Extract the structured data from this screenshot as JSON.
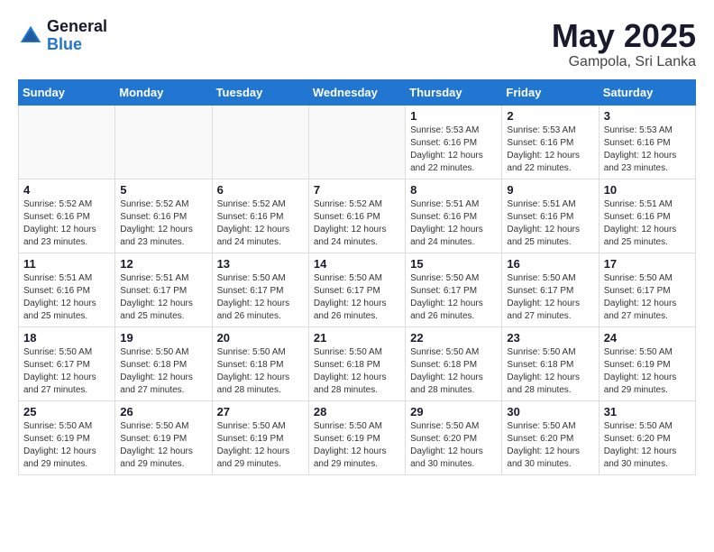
{
  "header": {
    "logo_general": "General",
    "logo_blue": "Blue",
    "title": "May 2025",
    "location": "Gampola, Sri Lanka"
  },
  "weekdays": [
    "Sunday",
    "Monday",
    "Tuesday",
    "Wednesday",
    "Thursday",
    "Friday",
    "Saturday"
  ],
  "weeks": [
    [
      {
        "day": "",
        "info": ""
      },
      {
        "day": "",
        "info": ""
      },
      {
        "day": "",
        "info": ""
      },
      {
        "day": "",
        "info": ""
      },
      {
        "day": "1",
        "info": "Sunrise: 5:53 AM\nSunset: 6:16 PM\nDaylight: 12 hours\nand 22 minutes."
      },
      {
        "day": "2",
        "info": "Sunrise: 5:53 AM\nSunset: 6:16 PM\nDaylight: 12 hours\nand 22 minutes."
      },
      {
        "day": "3",
        "info": "Sunrise: 5:53 AM\nSunset: 6:16 PM\nDaylight: 12 hours\nand 23 minutes."
      }
    ],
    [
      {
        "day": "4",
        "info": "Sunrise: 5:52 AM\nSunset: 6:16 PM\nDaylight: 12 hours\nand 23 minutes."
      },
      {
        "day": "5",
        "info": "Sunrise: 5:52 AM\nSunset: 6:16 PM\nDaylight: 12 hours\nand 23 minutes."
      },
      {
        "day": "6",
        "info": "Sunrise: 5:52 AM\nSunset: 6:16 PM\nDaylight: 12 hours\nand 24 minutes."
      },
      {
        "day": "7",
        "info": "Sunrise: 5:52 AM\nSunset: 6:16 PM\nDaylight: 12 hours\nand 24 minutes."
      },
      {
        "day": "8",
        "info": "Sunrise: 5:51 AM\nSunset: 6:16 PM\nDaylight: 12 hours\nand 24 minutes."
      },
      {
        "day": "9",
        "info": "Sunrise: 5:51 AM\nSunset: 6:16 PM\nDaylight: 12 hours\nand 25 minutes."
      },
      {
        "day": "10",
        "info": "Sunrise: 5:51 AM\nSunset: 6:16 PM\nDaylight: 12 hours\nand 25 minutes."
      }
    ],
    [
      {
        "day": "11",
        "info": "Sunrise: 5:51 AM\nSunset: 6:16 PM\nDaylight: 12 hours\nand 25 minutes."
      },
      {
        "day": "12",
        "info": "Sunrise: 5:51 AM\nSunset: 6:17 PM\nDaylight: 12 hours\nand 25 minutes."
      },
      {
        "day": "13",
        "info": "Sunrise: 5:50 AM\nSunset: 6:17 PM\nDaylight: 12 hours\nand 26 minutes."
      },
      {
        "day": "14",
        "info": "Sunrise: 5:50 AM\nSunset: 6:17 PM\nDaylight: 12 hours\nand 26 minutes."
      },
      {
        "day": "15",
        "info": "Sunrise: 5:50 AM\nSunset: 6:17 PM\nDaylight: 12 hours\nand 26 minutes."
      },
      {
        "day": "16",
        "info": "Sunrise: 5:50 AM\nSunset: 6:17 PM\nDaylight: 12 hours\nand 27 minutes."
      },
      {
        "day": "17",
        "info": "Sunrise: 5:50 AM\nSunset: 6:17 PM\nDaylight: 12 hours\nand 27 minutes."
      }
    ],
    [
      {
        "day": "18",
        "info": "Sunrise: 5:50 AM\nSunset: 6:17 PM\nDaylight: 12 hours\nand 27 minutes."
      },
      {
        "day": "19",
        "info": "Sunrise: 5:50 AM\nSunset: 6:18 PM\nDaylight: 12 hours\nand 27 minutes."
      },
      {
        "day": "20",
        "info": "Sunrise: 5:50 AM\nSunset: 6:18 PM\nDaylight: 12 hours\nand 28 minutes."
      },
      {
        "day": "21",
        "info": "Sunrise: 5:50 AM\nSunset: 6:18 PM\nDaylight: 12 hours\nand 28 minutes."
      },
      {
        "day": "22",
        "info": "Sunrise: 5:50 AM\nSunset: 6:18 PM\nDaylight: 12 hours\nand 28 minutes."
      },
      {
        "day": "23",
        "info": "Sunrise: 5:50 AM\nSunset: 6:18 PM\nDaylight: 12 hours\nand 28 minutes."
      },
      {
        "day": "24",
        "info": "Sunrise: 5:50 AM\nSunset: 6:19 PM\nDaylight: 12 hours\nand 29 minutes."
      }
    ],
    [
      {
        "day": "25",
        "info": "Sunrise: 5:50 AM\nSunset: 6:19 PM\nDaylight: 12 hours\nand 29 minutes."
      },
      {
        "day": "26",
        "info": "Sunrise: 5:50 AM\nSunset: 6:19 PM\nDaylight: 12 hours\nand 29 minutes."
      },
      {
        "day": "27",
        "info": "Sunrise: 5:50 AM\nSunset: 6:19 PM\nDaylight: 12 hours\nand 29 minutes."
      },
      {
        "day": "28",
        "info": "Sunrise: 5:50 AM\nSunset: 6:19 PM\nDaylight: 12 hours\nand 29 minutes."
      },
      {
        "day": "29",
        "info": "Sunrise: 5:50 AM\nSunset: 6:20 PM\nDaylight: 12 hours\nand 30 minutes."
      },
      {
        "day": "30",
        "info": "Sunrise: 5:50 AM\nSunset: 6:20 PM\nDaylight: 12 hours\nand 30 minutes."
      },
      {
        "day": "31",
        "info": "Sunrise: 5:50 AM\nSunset: 6:20 PM\nDaylight: 12 hours\nand 30 minutes."
      }
    ]
  ]
}
